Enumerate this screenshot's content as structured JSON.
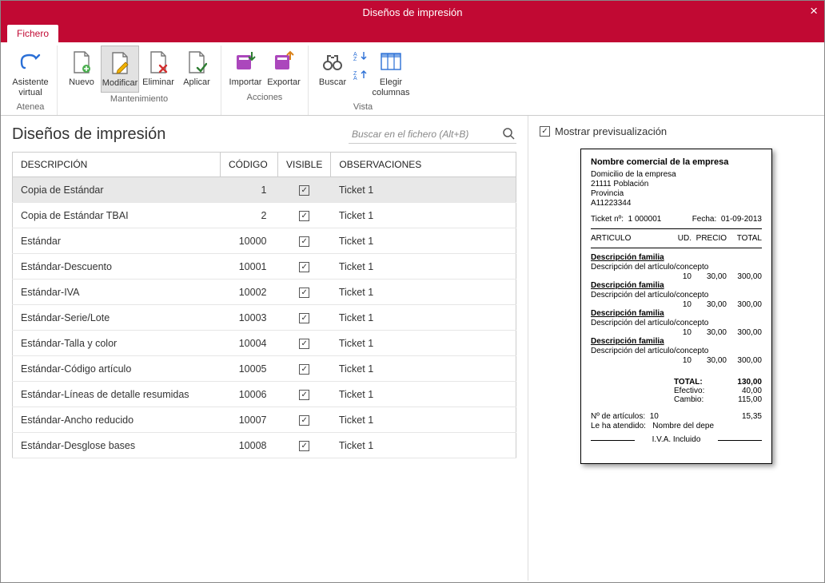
{
  "window": {
    "title": "Diseños de impresión",
    "tab": "Fichero"
  },
  "ribbon": {
    "groups": [
      {
        "label": "Atenea",
        "items": [
          {
            "key": "asistente",
            "label": "Asistente\nvirtual"
          }
        ]
      },
      {
        "label": "Mantenimiento",
        "items": [
          {
            "key": "nuevo",
            "label": "Nuevo"
          },
          {
            "key": "modificar",
            "label": "Modificar",
            "selected": true
          },
          {
            "key": "eliminar",
            "label": "Eliminar"
          },
          {
            "key": "aplicar",
            "label": "Aplicar"
          }
        ]
      },
      {
        "label": "Acciones",
        "items": [
          {
            "key": "importar",
            "label": "Importar"
          },
          {
            "key": "exportar",
            "label": "Exportar"
          }
        ]
      },
      {
        "label": "Vista",
        "items": [
          {
            "key": "buscar",
            "label": "Buscar"
          },
          {
            "key": "sort",
            "label": ""
          },
          {
            "key": "elegircol",
            "label": "Elegir\ncolumnas"
          }
        ]
      }
    ]
  },
  "grid": {
    "title": "Diseños de impresión",
    "search_placeholder": "Buscar en el fichero (Alt+B)",
    "columns": {
      "desc": "DESCRIPCIÓN",
      "code": "CÓDIGO",
      "visible": "VISIBLE",
      "obs": "OBSERVACIONES"
    },
    "rows": [
      {
        "desc": "Copia de Estándar",
        "code": "1",
        "visible": true,
        "obs": "Ticket 1",
        "selected": true
      },
      {
        "desc": "Copia de Estándar TBAI",
        "code": "2",
        "visible": true,
        "obs": "Ticket 1"
      },
      {
        "desc": "Estándar",
        "code": "10000",
        "visible": true,
        "obs": "Ticket 1"
      },
      {
        "desc": "Estándar-Descuento",
        "code": "10001",
        "visible": true,
        "obs": "Ticket 1"
      },
      {
        "desc": "Estándar-IVA",
        "code": "10002",
        "visible": true,
        "obs": "Ticket 1"
      },
      {
        "desc": "Estándar-Serie/Lote",
        "code": "10003",
        "visible": true,
        "obs": "Ticket 1"
      },
      {
        "desc": "Estándar-Talla y color",
        "code": "10004",
        "visible": true,
        "obs": "Ticket 1"
      },
      {
        "desc": "Estándar-Código artículo",
        "code": "10005",
        "visible": true,
        "obs": "Ticket 1"
      },
      {
        "desc": "Estándar-Líneas de detalle resumidas",
        "code": "10006",
        "visible": true,
        "obs": "Ticket 1"
      },
      {
        "desc": "Estándar-Ancho reducido",
        "code": "10007",
        "visible": true,
        "obs": "Ticket 1"
      },
      {
        "desc": "Estándar-Desglose bases",
        "code": "10008",
        "visible": true,
        "obs": "Ticket 1"
      }
    ]
  },
  "right": {
    "show_preview_label": "Mostrar previsualización",
    "show_preview_checked": true,
    "preview": {
      "company": "Nombre comercial de la empresa",
      "addr1": "Domicilio de la empresa",
      "addr2": "21111    Población",
      "addr3": "Provincia",
      "addr4": "A11223344",
      "ticket_no_label": "Ticket nº:",
      "ticket_no": "1    000001",
      "date_label": "Fecha:",
      "date": "01-09-2013",
      "col_art": "ARTICULO",
      "col_ud": "UD.",
      "col_precio": "PRECIO",
      "col_total": "TOTAL",
      "family_label": "Descripción familia",
      "item_label": "Descripción del artículo/concepto",
      "qty": "10",
      "price": "30,00",
      "line_total": "300,00",
      "total_label": "TOTAL:",
      "total_value": "130,00",
      "efectivo_label": "Efectivo:",
      "efectivo_value": "40,00",
      "cambio_label": "Cambio:",
      "cambio_value": "115,00",
      "n_articulos_label": "Nº de artículos:",
      "n_articulos": "10",
      "n_articulos_right": "15,35",
      "attended_label": "Le ha atendido:",
      "attended_value": "Nombre del depe",
      "iva": "I.V.A. Incluido"
    }
  }
}
